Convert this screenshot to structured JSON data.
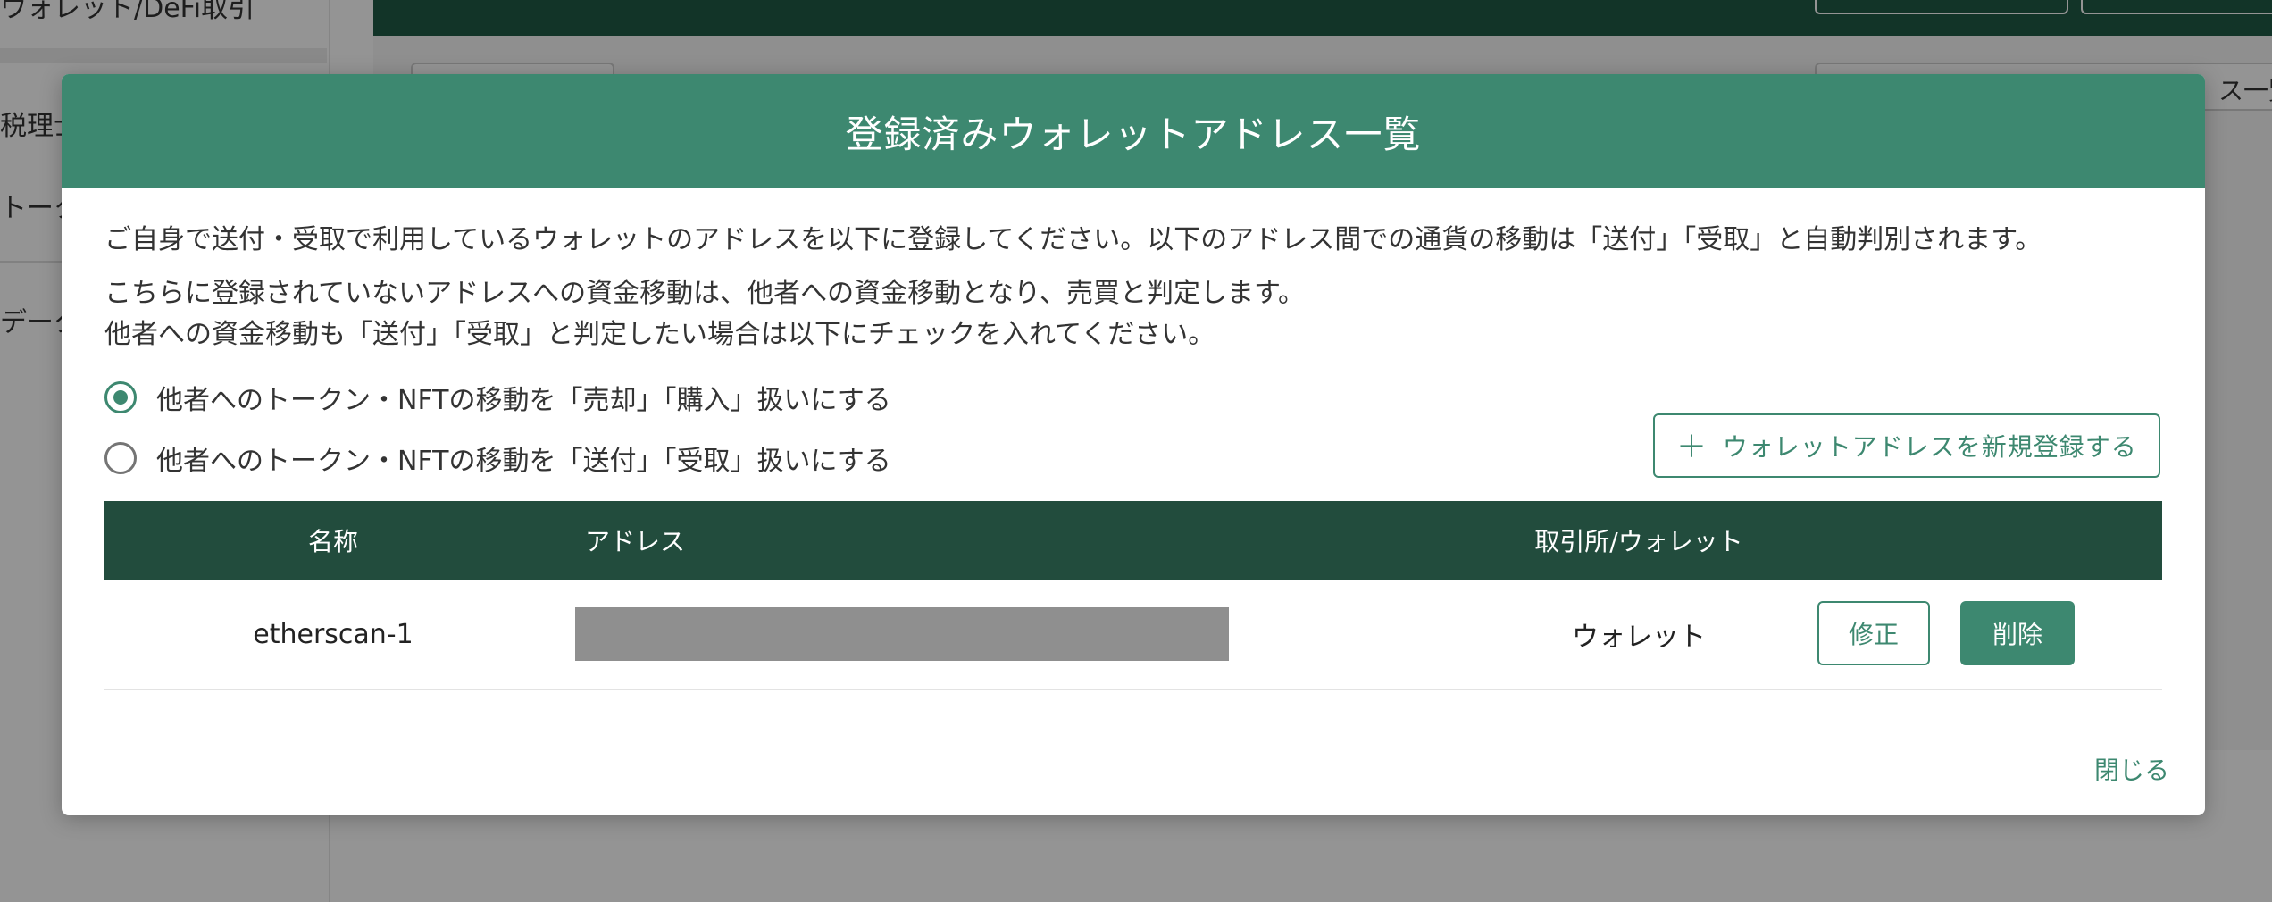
{
  "background": {
    "sidebar": {
      "items": [
        "ウォレット/DeFi取引",
        "税理士",
        "トーク",
        "データ"
      ]
    },
    "content_button_label": "ス一覧"
  },
  "modal": {
    "title": "登録済みウォレットアドレス一覧",
    "description_line1": "ご自身で送付・受取で利用しているウォレットのアドレスを以下に登録してください。以下のアドレス間での通貨の移動は「送付」「受取」と自動判別されます。",
    "description_line2": "こちらに登録されていないアドレスへの資金移動は、他者への資金移動となり、売買と判定します。",
    "description_line3": "他者への資金移動も「送付」「受取」と判定したい場合は以下にチェックを入れてください。",
    "options": [
      {
        "label": "他者へのトークン・NFTの移動を「売却」「購入」扱いにする",
        "selected": true
      },
      {
        "label": "他者へのトークン・NFTの移動を「送付」「受取」扱いにする",
        "selected": false
      }
    ],
    "add_button_label": "ウォレットアドレスを新規登録する",
    "add_button_icon": "plus-icon",
    "table": {
      "headers": {
        "name": "名称",
        "address": "アドレス",
        "exchange": "取引所/ウォレット"
      },
      "rows": [
        {
          "name": "etherscan-1",
          "exchange": "ウォレット",
          "edit_label": "修正",
          "delete_label": "削除"
        }
      ]
    },
    "close_label": "閉じる"
  },
  "colors": {
    "accent": "#3d8870",
    "table_header": "#224c3d",
    "app_header": "#1f5a45"
  }
}
